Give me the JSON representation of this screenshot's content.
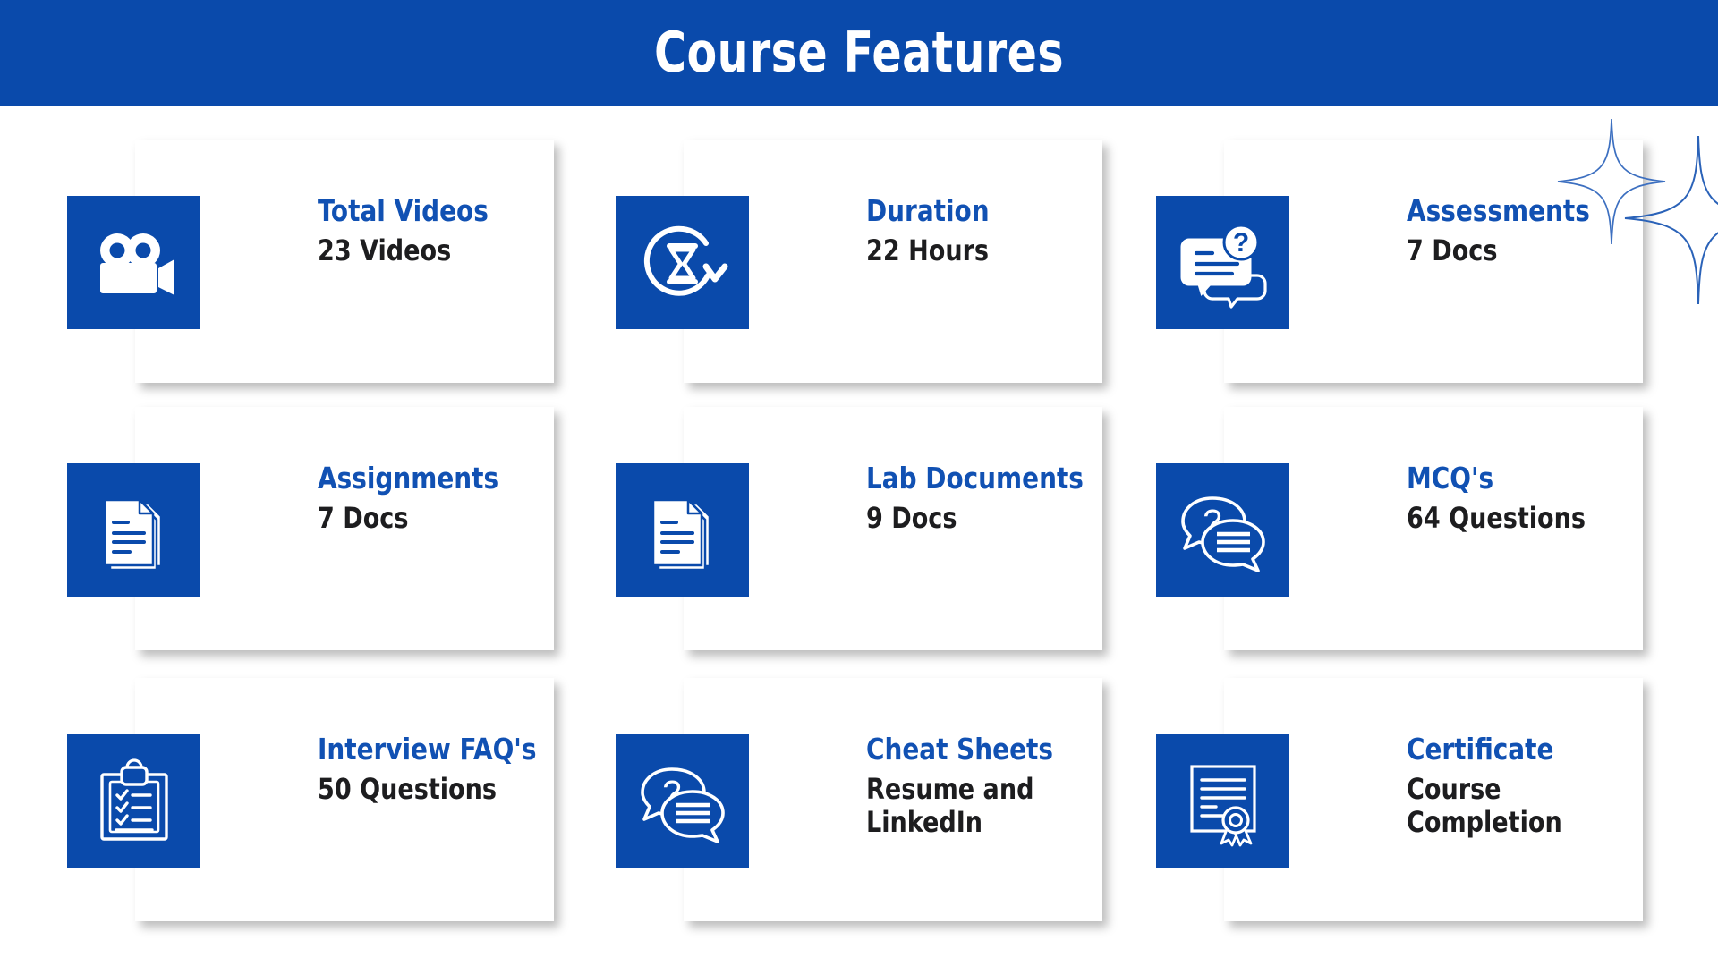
{
  "header": {
    "title": "Course Features",
    "bg_color": "#0a4aab",
    "title_color": "#ffffff"
  },
  "theme": {
    "accent_blue": "#0a4aab",
    "label_blue": "#1151b3",
    "value_black": "#1d1d1f",
    "card_bg": "#ffffff",
    "page_bg": "#ffffff"
  },
  "decorations": [
    {
      "name": "sparkle-top",
      "shape": "four-point-star-outline",
      "color": "#ffffff"
    },
    {
      "name": "sparkle-mid",
      "shape": "four-point-star-outline",
      "color": "#3c6fc0"
    },
    {
      "name": "sparkle-big",
      "shape": "four-point-star-outline",
      "color": "#2a62b8"
    }
  ],
  "cards": [
    {
      "icon": "video-camera-icon",
      "label": "Total Videos",
      "value": "23 Videos"
    },
    {
      "icon": "hourglass-refresh-icon",
      "label": "Duration",
      "value": "22 Hours"
    },
    {
      "icon": "speech-bubble-question-icon",
      "label": "Assessments",
      "value": "7 Docs"
    },
    {
      "icon": "documents-stack-icon",
      "label": "Assignments",
      "value": "7 Docs"
    },
    {
      "icon": "documents-stack-icon",
      "label": "Lab Documents",
      "value": "9 Docs"
    },
    {
      "icon": "chat-bubbles-question-icon",
      "label": "MCQ's",
      "value": "64 Questions"
    },
    {
      "icon": "clipboard-checklist-icon",
      "label": "Interview FAQ's",
      "value": "50 Questions"
    },
    {
      "icon": "chat-bubbles-question-icon",
      "label": "Cheat Sheets",
      "value": "Resume and LinkedIn"
    },
    {
      "icon": "certificate-ribbon-icon",
      "label": "Certificate",
      "value": "Course Completion"
    }
  ]
}
